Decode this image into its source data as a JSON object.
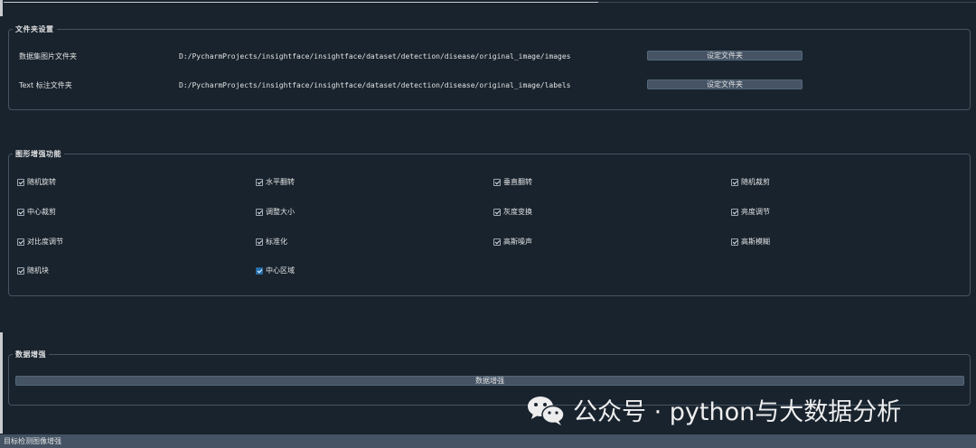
{
  "folder_settings": {
    "title": "文件夹设置",
    "rows": [
      {
        "label": "数据集图片文件夹",
        "path": "D:/PycharmProjects/insightface/insightface/dataset/detection/disease/original_image/images",
        "button": "设定文件夹"
      },
      {
        "label": "Text 标注文件夹",
        "path": "D:/PycharmProjects/insightface/insightface/dataset/detection/disease/original_image/labels",
        "button": "设定文件夹"
      }
    ]
  },
  "augment_functions": {
    "title": "图形增强功能",
    "options": [
      {
        "label": "随机旋转",
        "checked": true
      },
      {
        "label": "水平翻转",
        "checked": true
      },
      {
        "label": "垂直翻转",
        "checked": true
      },
      {
        "label": "随机裁剪",
        "checked": true
      },
      {
        "label": "中心裁剪",
        "checked": true
      },
      {
        "label": "调整大小",
        "checked": true
      },
      {
        "label": "灰度变换",
        "checked": true
      },
      {
        "label": "亮度调节",
        "checked": true
      },
      {
        "label": "对比度调节",
        "checked": true
      },
      {
        "label": "标准化",
        "checked": true
      },
      {
        "label": "高斯噪声",
        "checked": true
      },
      {
        "label": "高斯模糊",
        "checked": true
      },
      {
        "label": "随机块",
        "checked": true
      },
      {
        "label": "中心区域",
        "checked": true,
        "focused": true
      }
    ]
  },
  "data_augment": {
    "title": "数据增强",
    "button": "数据增强"
  },
  "status_bar": {
    "text": "目标检测图像增强"
  },
  "watermark": {
    "text": "公众号 · python与大数据分析",
    "icon": "wechat-icon"
  },
  "colors": {
    "background": "#19232d",
    "button": "#455364",
    "border": "#455364",
    "accent": "#1a72bb"
  }
}
